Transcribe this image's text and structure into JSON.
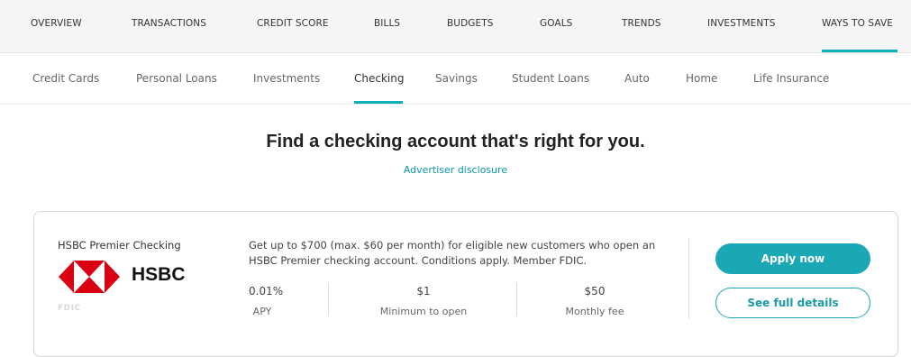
{
  "top_nav": {
    "items": [
      "OVERVIEW",
      "TRANSACTIONS",
      "CREDIT SCORE",
      "BILLS",
      "BUDGETS",
      "GOALS",
      "TRENDS",
      "INVESTMENTS",
      "WAYS TO SAVE"
    ],
    "active": "WAYS TO SAVE"
  },
  "sub_nav": {
    "items": [
      "Credit Cards",
      "Personal Loans",
      "Investments",
      "Checking",
      "Savings",
      "Student Loans",
      "Auto",
      "Home",
      "Life Insurance"
    ],
    "active": "Checking"
  },
  "main": {
    "headline": "Find a checking account that's right for you.",
    "disclosure": "Advertiser disclosure"
  },
  "offer": {
    "product_name": "HSBC Premier Checking",
    "logo_text": "HSBC",
    "fdic_text": "FDIC",
    "description": "Get up to $700 (max. $60 per month) for eligible new customers who open an HSBC Premier checking account. Conditions apply. Member FDIC.",
    "stats": [
      {
        "value": "0.01%",
        "label": "APY"
      },
      {
        "value": "$1",
        "label": "Minimum to open"
      },
      {
        "value": "$50",
        "label": "Monthly fee"
      }
    ],
    "apply_label": "Apply now",
    "details_label": "See full details"
  },
  "colors": {
    "accent": "#1ba8b5",
    "logo_red": "#db0011"
  }
}
